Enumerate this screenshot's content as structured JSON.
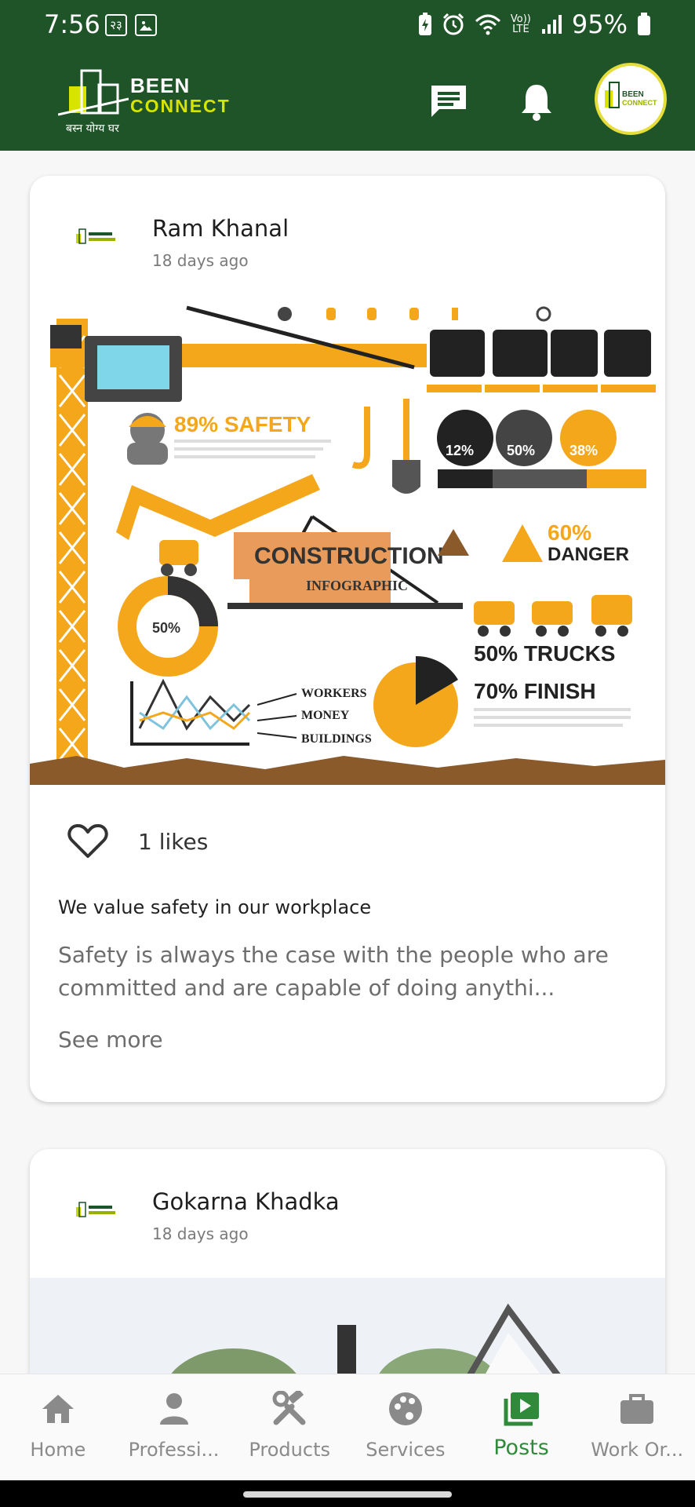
{
  "status_bar": {
    "time": "7:56",
    "calendar_badge": "२३",
    "volte_line1": "Vo))",
    "volte_line2": "LTE",
    "battery": "95%"
  },
  "header": {
    "logo_word1": "BEEN",
    "logo_word2": "CONNECT",
    "logo_tagline": "बस्न योग्य घर",
    "avatar_text_1": "BEEN",
    "avatar_text_2": "CONNECT",
    "messages_icon": "chat-icon",
    "notifications_icon": "bell-icon"
  },
  "posts": [
    {
      "author": "Ram Khanal",
      "time_ago": "18 days ago",
      "likes_label": "1 likes",
      "title": "We value safety in our workplace",
      "body": "Safety is always the case with the people who are committed and are capable of doing anythi...",
      "see_more": "See more",
      "infographic": {
        "safety": "89% SAFETY",
        "construction": "CONSTRUCTION",
        "infographic": "INFOGRAPHIC",
        "pct_12": "12%",
        "pct_50": "50%",
        "pct_38": "38%",
        "danger_pct": "60%",
        "danger": "DANGER",
        "donut_pct": "50%",
        "trucks": "50% TRUCKS",
        "finish": "70% FINISH",
        "workers": "WORKERS",
        "money": "MONEY",
        "buildings": "BUILDINGS"
      }
    },
    {
      "author": "Gokarna Khadka",
      "time_ago": "18 days ago"
    }
  ],
  "bottom_nav": [
    {
      "label": "Home",
      "icon": "home-icon",
      "active": false
    },
    {
      "label": "Professi...",
      "icon": "person-icon",
      "active": false
    },
    {
      "label": "Products",
      "icon": "tools-icon",
      "active": false
    },
    {
      "label": "Services",
      "icon": "palette-icon",
      "active": false
    },
    {
      "label": "Posts",
      "icon": "posts-icon",
      "active": true
    },
    {
      "label": "Work Or...",
      "icon": "briefcase-icon",
      "active": false
    }
  ],
  "colors": {
    "header_green": "#1f5428",
    "active_green": "#2f8a3a",
    "logo_accent": "#d6e400",
    "infographic_yellow": "#f5a71b"
  }
}
